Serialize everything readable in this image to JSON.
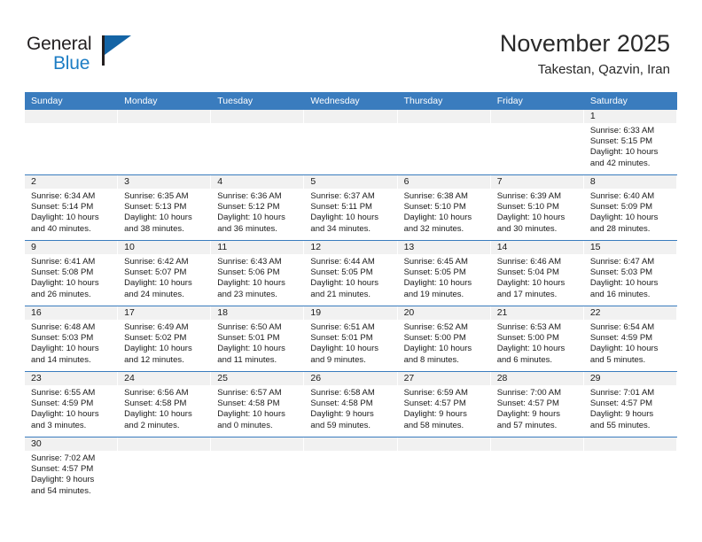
{
  "brand": {
    "name_top": "General",
    "name_bottom": "Blue",
    "accent_color": "#1464a5",
    "blue_text_color": "#1d7dc4"
  },
  "header": {
    "month_title": "November 2025",
    "location": "Takestan, Qazvin, Iran"
  },
  "calendar": {
    "header_color": "#3a7cbe",
    "band_color": "#f1f1f1",
    "weekdays": [
      "Sunday",
      "Monday",
      "Tuesday",
      "Wednesday",
      "Thursday",
      "Friday",
      "Saturday"
    ],
    "weeks": [
      [
        {
          "day": "",
          "lines": []
        },
        {
          "day": "",
          "lines": []
        },
        {
          "day": "",
          "lines": []
        },
        {
          "day": "",
          "lines": []
        },
        {
          "day": "",
          "lines": []
        },
        {
          "day": "",
          "lines": []
        },
        {
          "day": "1",
          "lines": [
            "Sunrise: 6:33 AM",
            "Sunset: 5:15 PM",
            "Daylight: 10 hours",
            "and 42 minutes."
          ]
        }
      ],
      [
        {
          "day": "2",
          "lines": [
            "Sunrise: 6:34 AM",
            "Sunset: 5:14 PM",
            "Daylight: 10 hours",
            "and 40 minutes."
          ]
        },
        {
          "day": "3",
          "lines": [
            "Sunrise: 6:35 AM",
            "Sunset: 5:13 PM",
            "Daylight: 10 hours",
            "and 38 minutes."
          ]
        },
        {
          "day": "4",
          "lines": [
            "Sunrise: 6:36 AM",
            "Sunset: 5:12 PM",
            "Daylight: 10 hours",
            "and 36 minutes."
          ]
        },
        {
          "day": "5",
          "lines": [
            "Sunrise: 6:37 AM",
            "Sunset: 5:11 PM",
            "Daylight: 10 hours",
            "and 34 minutes."
          ]
        },
        {
          "day": "6",
          "lines": [
            "Sunrise: 6:38 AM",
            "Sunset: 5:10 PM",
            "Daylight: 10 hours",
            "and 32 minutes."
          ]
        },
        {
          "day": "7",
          "lines": [
            "Sunrise: 6:39 AM",
            "Sunset: 5:10 PM",
            "Daylight: 10 hours",
            "and 30 minutes."
          ]
        },
        {
          "day": "8",
          "lines": [
            "Sunrise: 6:40 AM",
            "Sunset: 5:09 PM",
            "Daylight: 10 hours",
            "and 28 minutes."
          ]
        }
      ],
      [
        {
          "day": "9",
          "lines": [
            "Sunrise: 6:41 AM",
            "Sunset: 5:08 PM",
            "Daylight: 10 hours",
            "and 26 minutes."
          ]
        },
        {
          "day": "10",
          "lines": [
            "Sunrise: 6:42 AM",
            "Sunset: 5:07 PM",
            "Daylight: 10 hours",
            "and 24 minutes."
          ]
        },
        {
          "day": "11",
          "lines": [
            "Sunrise: 6:43 AM",
            "Sunset: 5:06 PM",
            "Daylight: 10 hours",
            "and 23 minutes."
          ]
        },
        {
          "day": "12",
          "lines": [
            "Sunrise: 6:44 AM",
            "Sunset: 5:05 PM",
            "Daylight: 10 hours",
            "and 21 minutes."
          ]
        },
        {
          "day": "13",
          "lines": [
            "Sunrise: 6:45 AM",
            "Sunset: 5:05 PM",
            "Daylight: 10 hours",
            "and 19 minutes."
          ]
        },
        {
          "day": "14",
          "lines": [
            "Sunrise: 6:46 AM",
            "Sunset: 5:04 PM",
            "Daylight: 10 hours",
            "and 17 minutes."
          ]
        },
        {
          "day": "15",
          "lines": [
            "Sunrise: 6:47 AM",
            "Sunset: 5:03 PM",
            "Daylight: 10 hours",
            "and 16 minutes."
          ]
        }
      ],
      [
        {
          "day": "16",
          "lines": [
            "Sunrise: 6:48 AM",
            "Sunset: 5:03 PM",
            "Daylight: 10 hours",
            "and 14 minutes."
          ]
        },
        {
          "day": "17",
          "lines": [
            "Sunrise: 6:49 AM",
            "Sunset: 5:02 PM",
            "Daylight: 10 hours",
            "and 12 minutes."
          ]
        },
        {
          "day": "18",
          "lines": [
            "Sunrise: 6:50 AM",
            "Sunset: 5:01 PM",
            "Daylight: 10 hours",
            "and 11 minutes."
          ]
        },
        {
          "day": "19",
          "lines": [
            "Sunrise: 6:51 AM",
            "Sunset: 5:01 PM",
            "Daylight: 10 hours",
            "and 9 minutes."
          ]
        },
        {
          "day": "20",
          "lines": [
            "Sunrise: 6:52 AM",
            "Sunset: 5:00 PM",
            "Daylight: 10 hours",
            "and 8 minutes."
          ]
        },
        {
          "day": "21",
          "lines": [
            "Sunrise: 6:53 AM",
            "Sunset: 5:00 PM",
            "Daylight: 10 hours",
            "and 6 minutes."
          ]
        },
        {
          "day": "22",
          "lines": [
            "Sunrise: 6:54 AM",
            "Sunset: 4:59 PM",
            "Daylight: 10 hours",
            "and 5 minutes."
          ]
        }
      ],
      [
        {
          "day": "23",
          "lines": [
            "Sunrise: 6:55 AM",
            "Sunset: 4:59 PM",
            "Daylight: 10 hours",
            "and 3 minutes."
          ]
        },
        {
          "day": "24",
          "lines": [
            "Sunrise: 6:56 AM",
            "Sunset: 4:58 PM",
            "Daylight: 10 hours",
            "and 2 minutes."
          ]
        },
        {
          "day": "25",
          "lines": [
            "Sunrise: 6:57 AM",
            "Sunset: 4:58 PM",
            "Daylight: 10 hours",
            "and 0 minutes."
          ]
        },
        {
          "day": "26",
          "lines": [
            "Sunrise: 6:58 AM",
            "Sunset: 4:58 PM",
            "Daylight: 9 hours",
            "and 59 minutes."
          ]
        },
        {
          "day": "27",
          "lines": [
            "Sunrise: 6:59 AM",
            "Sunset: 4:57 PM",
            "Daylight: 9 hours",
            "and 58 minutes."
          ]
        },
        {
          "day": "28",
          "lines": [
            "Sunrise: 7:00 AM",
            "Sunset: 4:57 PM",
            "Daylight: 9 hours",
            "and 57 minutes."
          ]
        },
        {
          "day": "29",
          "lines": [
            "Sunrise: 7:01 AM",
            "Sunset: 4:57 PM",
            "Daylight: 9 hours",
            "and 55 minutes."
          ]
        }
      ],
      [
        {
          "day": "30",
          "lines": [
            "Sunrise: 7:02 AM",
            "Sunset: 4:57 PM",
            "Daylight: 9 hours",
            "and 54 minutes."
          ]
        },
        {
          "day": "",
          "lines": []
        },
        {
          "day": "",
          "lines": []
        },
        {
          "day": "",
          "lines": []
        },
        {
          "day": "",
          "lines": []
        },
        {
          "day": "",
          "lines": []
        },
        {
          "day": "",
          "lines": []
        }
      ]
    ]
  }
}
